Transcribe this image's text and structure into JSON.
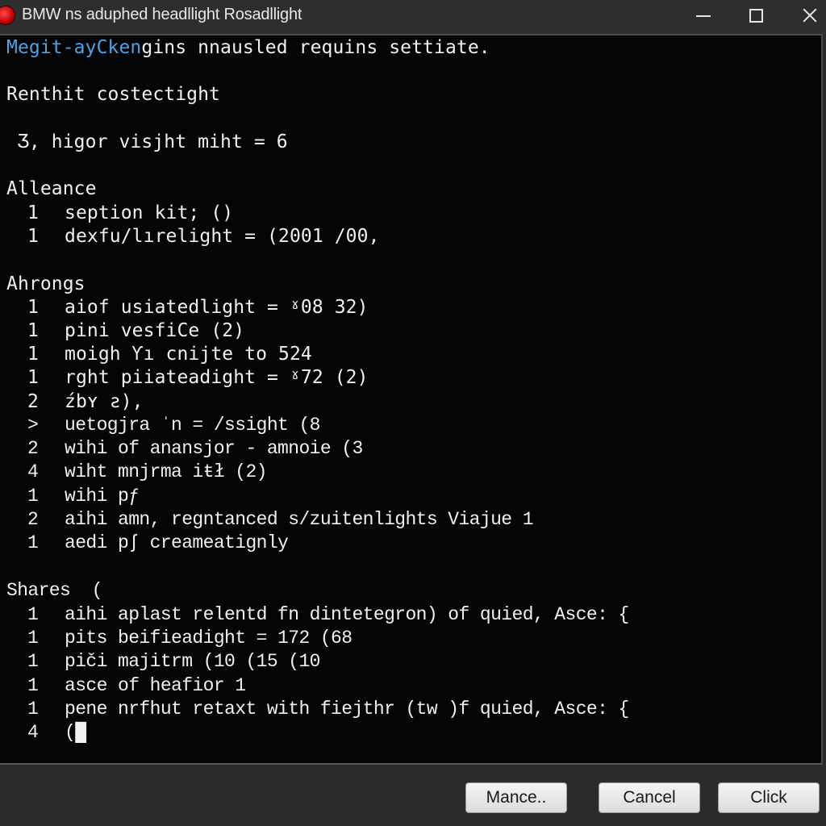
{
  "window": {
    "title": "BMW ns aduphed headllight Rosadllight",
    "icon": "app-icon-red-orb",
    "controls": {
      "minimize": "minimize-icon",
      "maximize": "maximize-icon",
      "close": "close-icon"
    }
  },
  "terminal": {
    "header": {
      "highlight": "Megit-ayCken",
      "rest": "gins nnausled requins settiate."
    },
    "intro": "Renthit costectight",
    "summary": " Ʒ, higor visjht miht = 6",
    "sections": [
      {
        "title": "Alleance",
        "rows": [
          {
            "n": "1",
            "text": "seption kit; ()"
          },
          {
            "n": "1",
            "text": "dexfu/lırelight = (2001 /00,"
          }
        ]
      },
      {
        "title": "Ahrongs",
        "rows": [
          {
            "n": "1",
            "text": "aiof usiatedlight = ˠ08 32)"
          },
          {
            "n": "1",
            "text": "pini vesfiCe (2)"
          },
          {
            "n": "1",
            "text": "moigh Ƴı cnijte to 524"
          },
          {
            "n": "1",
            "text": "rght piiateadight = ˠ72 (2)"
          },
          {
            "n": "2",
            "text": "źbʏ ƨ),"
          },
          {
            "n": ">",
            "text": "uetogjra ˈn = /ssight (8"
          },
          {
            "n": "2",
            "text": "wihi of anansjor - amnoie (3"
          },
          {
            "n": "4",
            "text": "wiht mnjrma iŧł (2)"
          },
          {
            "n": "1",
            "text": "wihi pƒ"
          },
          {
            "n": "2",
            "text": "aihi amn, regntanced s/zuitenlights Viajue 1"
          },
          {
            "n": "1",
            "text": "aedi pʃ creameatignly"
          }
        ]
      },
      {
        "title": "Shares  (",
        "rows": [
          {
            "n": "1",
            "text": "aihi aplast relentd fn dintetegron) of quied, Asce: {"
          },
          {
            "n": "1",
            "text": "pits beifieadight = 172 (68"
          },
          {
            "n": "1",
            "text": "piči majitrm (10 (15 (10"
          },
          {
            "n": "1",
            "text": "asce of heafior 1"
          },
          {
            "n": "1",
            "text": "pene nrfhut retaxt with fiejthr (tw )f quied, Asce: {"
          },
          {
            "n": "4",
            "text": "(█"
          }
        ]
      }
    ]
  },
  "buttons": {
    "first": "Mance..",
    "cancel": "Cancel",
    "click": "Click"
  }
}
